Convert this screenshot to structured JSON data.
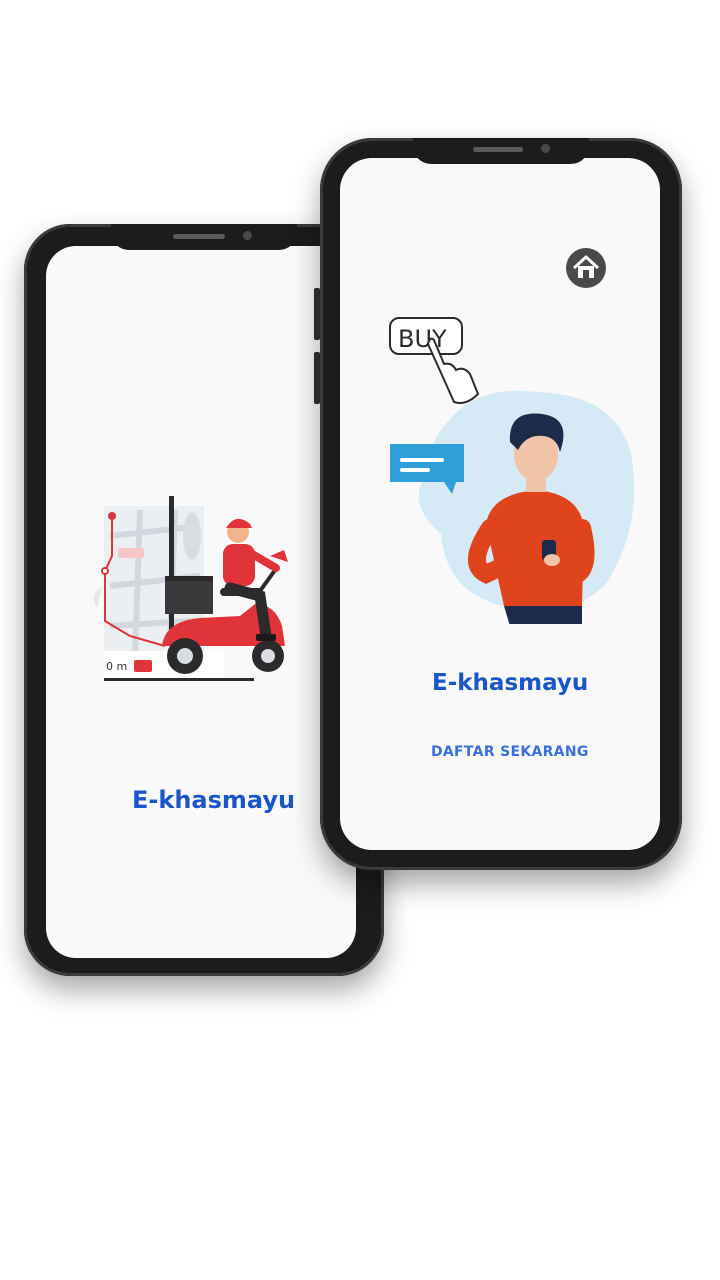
{
  "back_screen": {
    "brand_title": "E-khasmayu",
    "illustration": "delivery-scooter-map",
    "distance_label": "0 m"
  },
  "front_screen": {
    "home_icon": "home-icon",
    "buy_label": "BUY",
    "illustration": "man-shopping-on-phone",
    "brand_title": "E-khasmayu",
    "cta_label": "DAFTAR SEKARANG"
  },
  "colors": {
    "brand_blue": "#1a56c7",
    "cta_blue": "#3b6fe0",
    "accent_red": "#e0343a",
    "phone_frame": "#1c1c1e"
  }
}
